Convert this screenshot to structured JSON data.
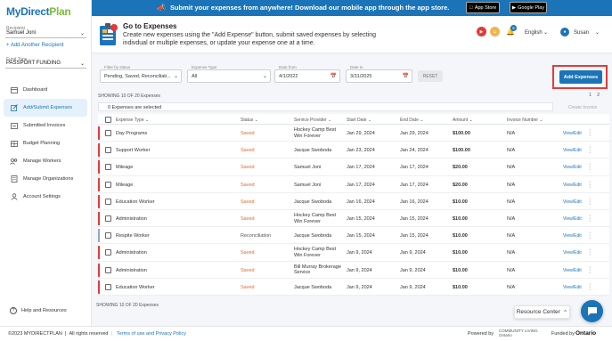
{
  "brand": {
    "logo_my": "My",
    "logo_direct": "Direct",
    "logo_plan": "Plan"
  },
  "sidebar": {
    "recipient_label": "Recipient",
    "recipient_value": "Samuel Joni",
    "add_recipient": "+ Add Another Recipient",
    "fund_type_label": "Fund Type",
    "fund_type_value": "PASSPORT FUNDING",
    "items": [
      {
        "label": "Dashboard",
        "icon": "dashboard-icon"
      },
      {
        "label": "Add/Submit Expenses",
        "icon": "edit-icon"
      },
      {
        "label": "Submitted Invoices",
        "icon": "invoice-icon"
      },
      {
        "label": "Budget Planning",
        "icon": "budget-icon"
      },
      {
        "label": "Manage Workers",
        "icon": "workers-icon"
      },
      {
        "label": "Manage Organizations",
        "icon": "organizations-icon"
      },
      {
        "label": "Account Settings",
        "icon": "account-icon"
      }
    ],
    "help": "Help and Resources"
  },
  "banner": {
    "text": "Submit your expenses from anywhere! Download our mobile app through the app store.",
    "app_store": "App Store",
    "google_play": "Google Play"
  },
  "header": {
    "title": "Go to Expenses",
    "description": "Create new expenses using the \"Add Expense\" button, submit saved expenses by selecting indivdual or multiple expenses, or update your expense one at a time.",
    "notification_count": "5",
    "language": "English",
    "user": "Susan"
  },
  "filters": {
    "status_label": "Filter by status",
    "status_value": "Pending, Saved, Reconciliati...",
    "type_label": "Expense Type",
    "type_value": "All",
    "date_from_label": "Date from",
    "date_from_value": "4/1/2022",
    "date_to_label": "Date to",
    "date_to_value": "3/31/2025",
    "reset": "RESET",
    "add_expenses": "Add Expenses"
  },
  "table_meta": {
    "showing_top": "SHOWING 10 OF 20 Expenses",
    "page_1": "1",
    "page_2": "2",
    "selected": "0 Expenses are selected",
    "create_invoice": "Create Invoice",
    "showing_bottom": "SHOWING 10 OF 20 Expenses"
  },
  "columns": [
    "Expense Type",
    "Status",
    "Service Provider",
    "Start Date",
    "End Date",
    "Amount",
    "Invoice Number"
  ],
  "rows": [
    {
      "type": "Day Programs",
      "status": "Saved",
      "provider": "Hockey Camp Best Win Forever",
      "start": "Jan 29, 2024",
      "end": "Jan 29, 2024",
      "amount": "$100.00",
      "invoice": "N/A",
      "action": "View/Edit",
      "flag": "#e23b3b"
    },
    {
      "type": "Support Worker",
      "status": "Saved",
      "provider": "Jacque Swoboda",
      "start": "Jan 23, 2024",
      "end": "Jan 24, 2024",
      "amount": "$100.00",
      "invoice": "N/A",
      "action": "View/Edit",
      "flag": "#e23b3b"
    },
    {
      "type": "Mileage",
      "status": "Saved",
      "provider": "Samuel Joni",
      "start": "Jan 17, 2024",
      "end": "Jan 17, 2024",
      "amount": "$20.00",
      "invoice": "N/A",
      "action": "View/Edit",
      "flag": "#e23b3b"
    },
    {
      "type": "Mileage",
      "status": "Saved",
      "provider": "Samuel Joni",
      "start": "Jan 17, 2024",
      "end": "Jan 17, 2024",
      "amount": "$20.00",
      "invoice": "N/A",
      "action": "View/Edit",
      "flag": "#e23b3b"
    },
    {
      "type": "Education Worker",
      "status": "Saved",
      "provider": "Jacque Swoboda",
      "start": "Jan 16, 2024",
      "end": "Jan 16, 2024",
      "amount": "$10.00",
      "invoice": "N/A",
      "action": "View/Edit",
      "flag": "#e23b3b"
    },
    {
      "type": "Administration",
      "status": "Saved",
      "provider": "Hockey Camp Best Win Forever",
      "start": "Jan 15, 2024",
      "end": "Jan 15, 2024",
      "amount": "$10.00",
      "invoice": "N/A",
      "action": "View/Edit",
      "flag": "#e23b3b"
    },
    {
      "type": "Respite Worker",
      "status": "Reconciliation",
      "provider": "Jacque Swoboda",
      "start": "Jan 15, 2024",
      "end": "Jan 15, 2024",
      "amount": "$10.00",
      "invoice": "N/A",
      "action": "View/Edit",
      "flag": "#90a8c8"
    },
    {
      "type": "Administration",
      "status": "Saved",
      "provider": "Hockey Camp Best Win Forever",
      "start": "Jan 9, 2024",
      "end": "Jan 9, 2024",
      "amount": "$10.00",
      "invoice": "N/A",
      "action": "View/Edit",
      "flag": "#e23b3b"
    },
    {
      "type": "Administration",
      "status": "Saved",
      "provider": "Bill Murray Brokerage Service",
      "start": "Jan 9, 2024",
      "end": "Jan 9, 2024",
      "amount": "$10.00",
      "invoice": "N/A",
      "action": "View/Edit",
      "flag": "#e23b3b"
    },
    {
      "type": "Education Worker",
      "status": "Saved",
      "provider": "Jacque Swoboda",
      "start": "Jan 9, 2024",
      "end": "Jan 9, 2024",
      "amount": "$10.00",
      "invoice": "N/A",
      "action": "View/Edit",
      "flag": "#e23b3b"
    }
  ],
  "widgets": {
    "resource_center": "Resource Center"
  },
  "footer": {
    "copyright": "©2023 MYDIRECTPLAN",
    "rights": "All rights reserved",
    "terms": "Terms of use and Privacy Policy",
    "powered": "Powered by",
    "community_living": "COMMUNITY LIVING",
    "community_living_sub": "Ontario",
    "funded": "Funded by",
    "ontario": "Ontario"
  },
  "colors": {
    "primary": "#1b74b8",
    "saved_status": "#e06b2c",
    "highlight": "#e23b3b"
  }
}
